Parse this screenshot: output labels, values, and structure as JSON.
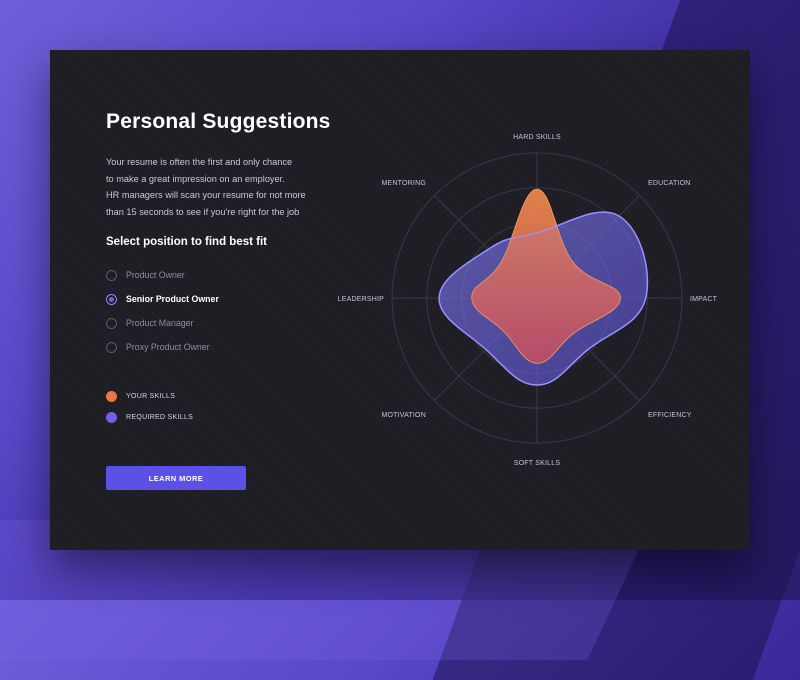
{
  "panel": {
    "title": "Personal Suggestions",
    "description": [
      "Your resume is often the first and only chance",
      "to make a great impression on an employer.",
      "HR managers will scan your resume for not more",
      "than 15 seconds to see if you're right for the job"
    ],
    "select_title": "Select position to find best fit",
    "positions": [
      {
        "label": "Product Owner",
        "selected": false
      },
      {
        "label": "Senior Product Owner",
        "selected": true
      },
      {
        "label": "Product Manager",
        "selected": false
      },
      {
        "label": "Proxy Product Owner",
        "selected": false
      }
    ],
    "legend": [
      {
        "label": "YOUR SKILLS",
        "color": "#e8764a"
      },
      {
        "label": "REQUIRED SKILLS",
        "color": "#6b63e8"
      }
    ],
    "button_label": "LEARN MORE"
  },
  "chart_data": {
    "type": "radar",
    "axes": [
      "HARD SKILLS",
      "EDUCATION",
      "IMPACT",
      "EFFICIENCY",
      "SOFT SKILLS",
      "MOTIVATION",
      "LEADERSHIP",
      "MENTORING"
    ],
    "scale_max": 4,
    "series": [
      {
        "name": "YOUR SKILLS",
        "color": "#e8764a",
        "values": [
          3.0,
          1.4,
          2.3,
          1.4,
          1.8,
          1.3,
          1.8,
          1.4
        ]
      },
      {
        "name": "REQUIRED SKILLS",
        "color": "#6b63e8",
        "values": [
          1.8,
          3.2,
          3.0,
          2.0,
          2.4,
          2.0,
          2.7,
          1.9
        ]
      }
    ]
  },
  "colors": {
    "accent": "#5b51e6",
    "card_bg": "#1f1d24",
    "your_skills": "#e8764a",
    "required_skills": "#6b63e8"
  }
}
